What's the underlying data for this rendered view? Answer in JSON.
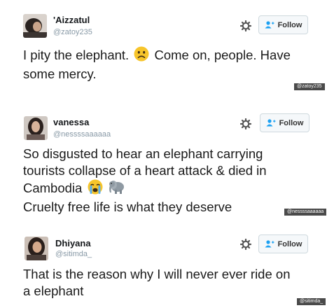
{
  "tweets": [
    {
      "display_name": "'Aizzatul",
      "handle": "@zatoy235",
      "follow_label": "Follow",
      "lines": [
        "I pity the elephant.",
        "Come on, people. Have",
        "some mercy."
      ],
      "emojis": [
        "disappointed-face"
      ],
      "watermark": "@zatoy235"
    },
    {
      "display_name": "vanessa",
      "handle": "@nessssaaaaaa",
      "follow_label": "Follow",
      "lines": [
        "So disgusted to hear an elephant carrying",
        "tourists collapse of a heart attack & died in",
        "Cambodia",
        "Cruelty free life is what they deserve"
      ],
      "emojis": [
        "crying-face",
        "elephant"
      ],
      "watermark": "@nessssaaaaaa"
    },
    {
      "display_name": "Dhiyana",
      "handle": "@sitimda_",
      "follow_label": "Follow",
      "lines": [
        "That is the reason why I will never ever ride on",
        "a elephant"
      ],
      "watermark": "@sitimda_"
    }
  ],
  "colors": {
    "follow_blue": "#1da1f2",
    "handle_gray": "#8899a6"
  }
}
